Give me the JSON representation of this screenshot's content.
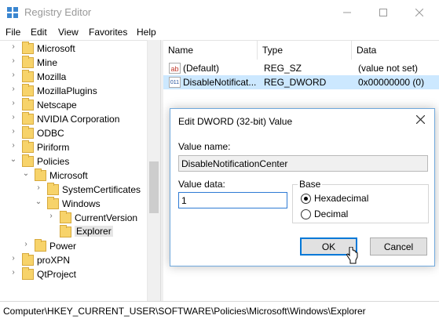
{
  "window": {
    "title": "Registry Editor"
  },
  "menu": [
    "File",
    "Edit",
    "View",
    "Favorites",
    "Help"
  ],
  "tree": [
    {
      "label": "Microsoft",
      "indent": 1,
      "state": "collapsed"
    },
    {
      "label": "Mine",
      "indent": 1,
      "state": "collapsed"
    },
    {
      "label": "Mozilla",
      "indent": 1,
      "state": "collapsed"
    },
    {
      "label": "MozillaPlugins",
      "indent": 1,
      "state": "collapsed"
    },
    {
      "label": "Netscape",
      "indent": 1,
      "state": "collapsed"
    },
    {
      "label": "NVIDIA Corporation",
      "indent": 1,
      "state": "collapsed"
    },
    {
      "label": "ODBC",
      "indent": 1,
      "state": "collapsed"
    },
    {
      "label": "Piriform",
      "indent": 1,
      "state": "collapsed"
    },
    {
      "label": "Policies",
      "indent": 1,
      "state": "expanded"
    },
    {
      "label": "Microsoft",
      "indent": 2,
      "state": "expanded"
    },
    {
      "label": "SystemCertificates",
      "indent": 3,
      "state": "collapsed"
    },
    {
      "label": "Windows",
      "indent": 3,
      "state": "expanded"
    },
    {
      "label": "CurrentVersion",
      "indent": 4,
      "state": "collapsed"
    },
    {
      "label": "Explorer",
      "indent": 4,
      "state": "none",
      "selected": true
    },
    {
      "label": "Power",
      "indent": 2,
      "state": "collapsed"
    },
    {
      "label": "proXPN",
      "indent": 1,
      "state": "collapsed"
    },
    {
      "label": "QtProject",
      "indent": 1,
      "state": "collapsed"
    }
  ],
  "columns": {
    "name": "Name",
    "type": "Type",
    "data": "Data"
  },
  "values": [
    {
      "icon": "ab",
      "name": "(Default)",
      "type": "REG_SZ",
      "data": "(value not set)",
      "selected": false
    },
    {
      "icon": "011",
      "name": "DisableNotificat...",
      "type": "REG_DWORD",
      "data": "0x00000000 (0)",
      "selected": true
    }
  ],
  "status": {
    "path": "Computer\\HKEY_CURRENT_USER\\SOFTWARE\\Policies\\Microsoft\\Windows\\Explorer"
  },
  "dialog": {
    "title": "Edit DWORD (32-bit) Value",
    "value_name_label": "Value name:",
    "value_name": "DisableNotificationCenter",
    "value_data_label": "Value data:",
    "value_data": "1",
    "base_label": "Base",
    "hex_label": "Hexadecimal",
    "dec_label": "Decimal",
    "base_selected": "Hexadecimal",
    "ok_label": "OK",
    "cancel_label": "Cancel"
  },
  "colors": {
    "selection": "#cce8ff",
    "accent": "#0078d7",
    "folder": "#f7d36a"
  }
}
